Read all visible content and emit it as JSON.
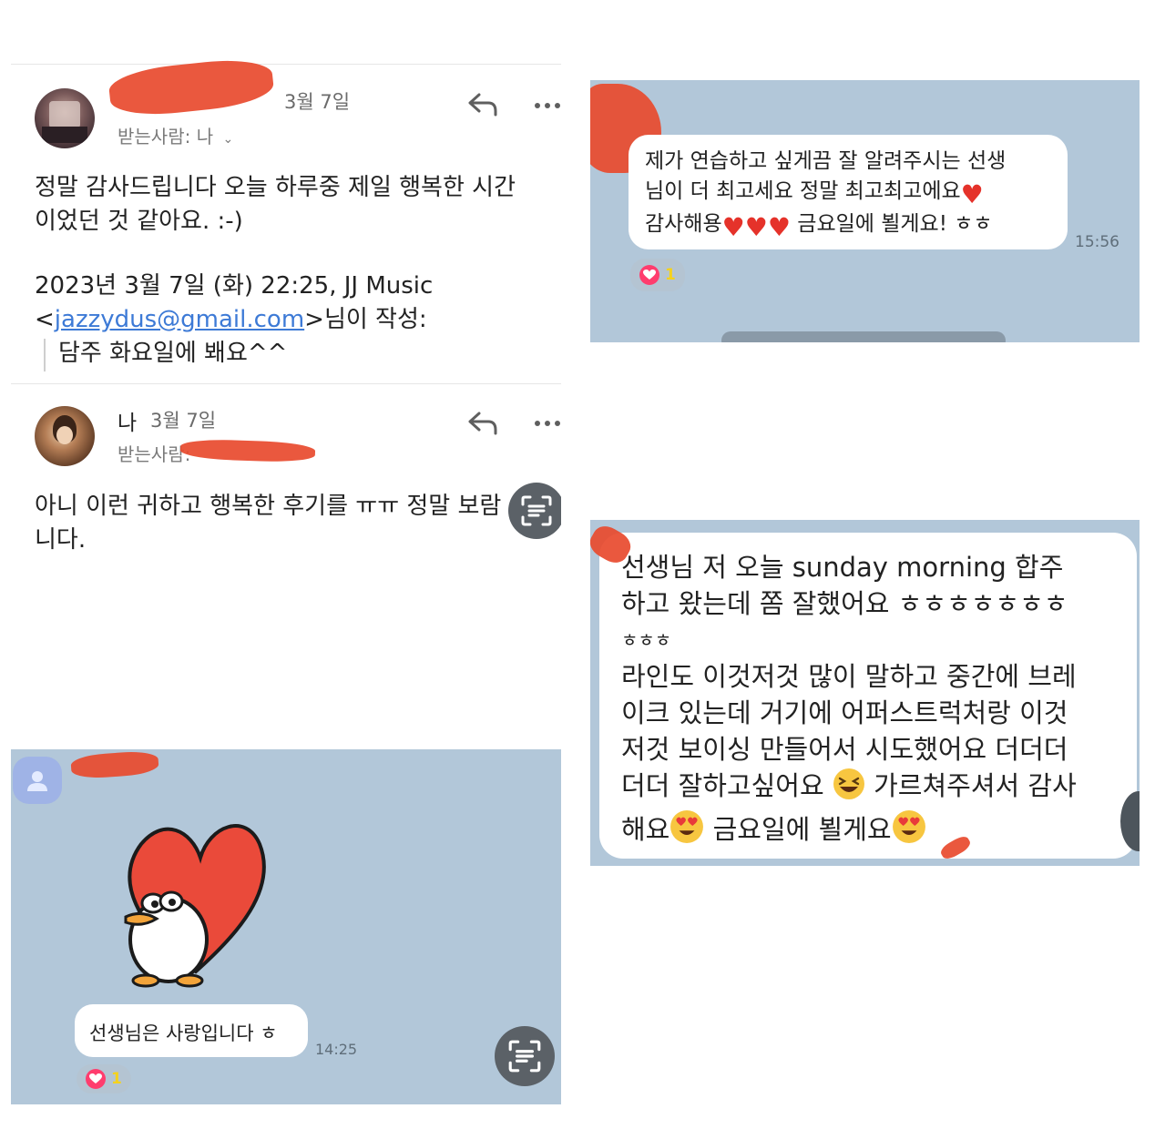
{
  "email": {
    "msg1": {
      "date": "3월 7일",
      "recipient": "받는사람: 나",
      "body_line1": "정말 감사드립니다 오늘 하루중 제일 행복한 시간",
      "body_line2": "이었던 것 같아요. :-)",
      "quote_header_line1": "2023년 3월 7일 (화) 22:25, JJ Music",
      "quote_open": "<",
      "quote_email": "jazzydus@gmail.com",
      "quote_close": ">님이 작성:",
      "quote_text": "담주 화요일에 봬요^^"
    },
    "msg2": {
      "sender": "나",
      "date": "3월 7일",
      "recipient": "받는사람:",
      "body_line1": "아니 이런 귀하고 행복한 후기를 ㅠㅠ 정말 보람",
      "body_line2": "니다."
    }
  },
  "chat_sticker": {
    "message": "선생님은 사랑입니다 ㅎ",
    "time": "14:25",
    "reaction_count": "1"
  },
  "chat_top_right": {
    "line1": "제가 연습하고 싶게끔 잘 알려주시는 선생",
    "line2": "님이 더 최고세요 정말 최고최고에요",
    "line3a": "감사해용",
    "line3b": " 금요일에 뵐게요! ㅎㅎ",
    "time": "15:56",
    "reaction_count": "1"
  },
  "chat_bottom_right": {
    "line1": "선생님 저 오늘 sunday morning 합주",
    "line2": "하고 왔는데 쫌 잘했어요 ㅎㅎㅎㅎㅎㅎㅎ",
    "line3": "ㅎㅎㅎ",
    "line4": "라인도 이것저것 많이 말하고 중간에 브레",
    "line5": "이크 있는데 거기에 어퍼스트럭처랑 이것",
    "line6": "저것 보이싱 만들어서 시도했어요 더더더",
    "line7a": "더더 잘하고싶어요 ",
    "line7b": " 가르쳐주셔서 감사",
    "line8a": "해요",
    "line8b": " 금요일에 뵐게요"
  },
  "colors": {
    "chat_bg": "#b2c7d9",
    "link": "#3d7ad6",
    "redaction": "#e84a2e",
    "heart": "#e5322a"
  },
  "icons": [
    "reply-icon",
    "more-icon",
    "chevron-down-icon",
    "visual-lookup-icon",
    "heart-icon",
    "profile-icon",
    "laughing-emoji-icon",
    "heart-eyes-emoji-icon"
  ]
}
